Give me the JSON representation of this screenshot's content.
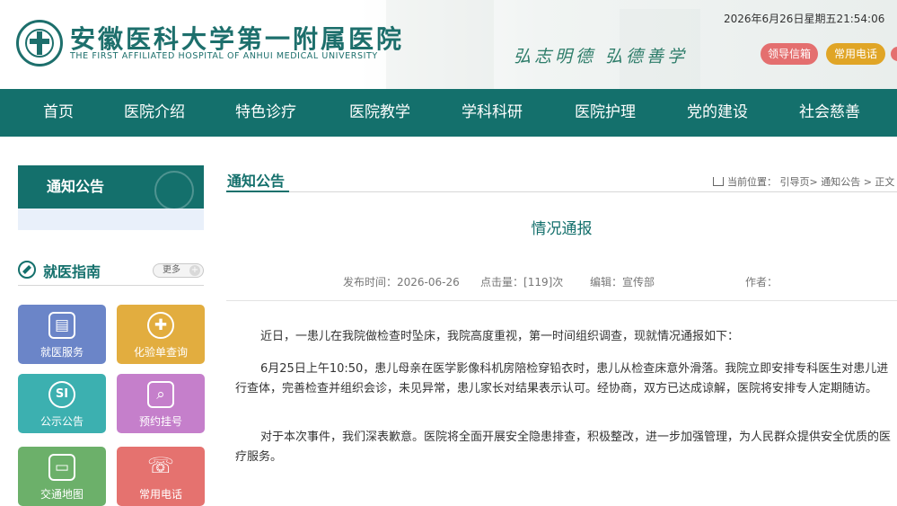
{
  "header": {
    "hospital_name_cn": "安徽医科大学第一附属医院",
    "hospital_name_en": "THE FIRST AFFILIATED HOSPITAL OF ANHUI MEDICAL UNIVERSITY",
    "motto": "弘志明德 弘德善学",
    "datetime": "2026年6月26日星期五21:54:06",
    "buttons": {
      "leader_mail": "领导信箱",
      "common_phone": "常用电话"
    }
  },
  "nav": {
    "items": [
      {
        "label": "首页"
      },
      {
        "label": "医院介绍"
      },
      {
        "label": "特色诊疗"
      },
      {
        "label": "医院教学"
      },
      {
        "label": "学科科研"
      },
      {
        "label": "医院护理"
      },
      {
        "label": "党的建设"
      },
      {
        "label": "社会慈善"
      }
    ]
  },
  "sidebar": {
    "notice_title": "通知公告",
    "guide_title": "就医指南",
    "more_label": "更多",
    "tiles": [
      {
        "label": "就医服务",
        "icon": "clipboard-icon",
        "color": "#6b85c8"
      },
      {
        "label": "化验单查询",
        "icon": "medical-cross-icon",
        "color": "#e2ad3f"
      },
      {
        "label": "公示公告",
        "icon": "si-icon",
        "color": "#3cb0b0"
      },
      {
        "label": "预约挂号",
        "icon": "register-icon",
        "color": "#c57fcb"
      },
      {
        "label": "交通地图",
        "icon": "car-icon",
        "color": "#6cb06a"
      },
      {
        "label": "常用电话",
        "icon": "phone-icon",
        "color": "#e5726f"
      }
    ]
  },
  "main": {
    "section_title": "通知公告",
    "breadcrumb": "当前位置： 引导页> 通知公告 > 正文",
    "article": {
      "title": "情况通报",
      "publish_label": "发布时间：",
      "publish_date": "2026-06-26",
      "clicks_label": "点击量：",
      "clicks_value": "[119]次",
      "editor_label": "编辑：",
      "editor_value": "宣传部",
      "author_label": "作者：",
      "paragraphs": [
        "近日，一患儿在我院做检查时坠床，我院高度重视，第一时间组织调查，现就情况通报如下：",
        "6月25日上午10:50，患儿母亲在医学影像科机房陪检穿铅衣时，患儿从检查床意外滑落。我院立即安排专科医生对患儿进行查体，完善检查并组织会诊，未见异常，患儿家长对结果表示认可。经协商，双方已达成谅解，医院将安排专人定期随访。",
        "对于本次事件，我们深表歉意。医院将全面开展安全隐患排查，积极整改，进一步加强管理，为人民群众提供安全优质的医疗服务。"
      ]
    }
  }
}
